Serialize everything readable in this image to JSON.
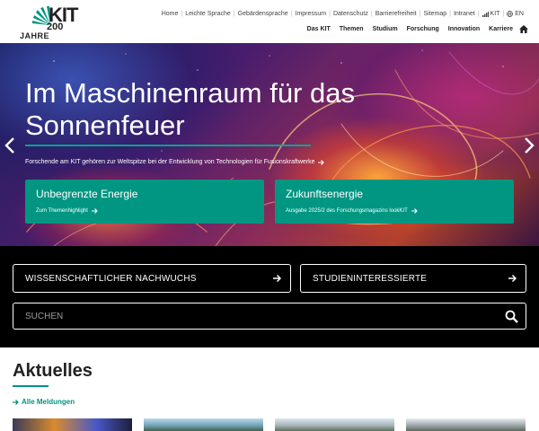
{
  "logo": {
    "brand": "KIT",
    "anniversary_number": "200",
    "anniversary_word": "JAHRE"
  },
  "meta_nav": {
    "items": [
      "Home",
      "Leichte Sprache",
      "Gebärdensprache",
      "Impressum",
      "Datenschutz",
      "Barrierefreiheit",
      "Sitemap",
      "Intranet",
      "KIT"
    ],
    "language": "EN"
  },
  "main_nav": {
    "items": [
      "Das KIT",
      "Themen",
      "Studium",
      "Forschung",
      "Innovation",
      "Karriere"
    ]
  },
  "hero": {
    "title": "Im Maschinenraum für das Sonnenfeuer",
    "subtitle": "Forschende am KIT gehören zur Weltspitze bei der Entwicklung von Technologien für Fusionskraftwerke"
  },
  "teasers": [
    {
      "title": "Unbegrenzte Energie",
      "link": "Zum Themenhighlight"
    },
    {
      "title": "Zukunftsenergie",
      "link": "Ausgabe 2025/2 des Forschungsmagazins lookKIT"
    }
  ],
  "quicklinks": [
    "WISSENSCHAFTLICHER NACHWUCHS",
    "STUDIENINTERESSIERTE"
  ],
  "search": {
    "placeholder": "SUCHEN"
  },
  "news": {
    "heading": "Aktuelles",
    "all_link": "Alle Meldungen"
  },
  "colors": {
    "kit_green": "#009682",
    "black_band": "#000000"
  }
}
